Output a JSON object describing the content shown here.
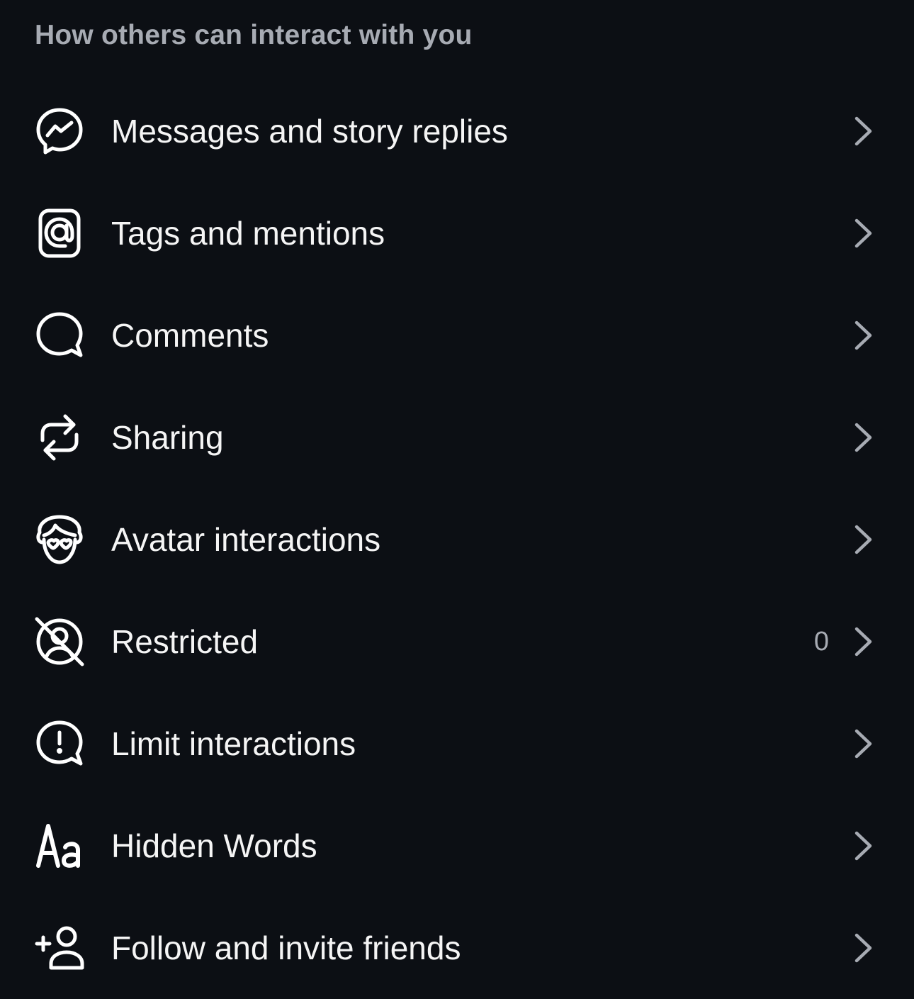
{
  "section": {
    "title": "How others can interact with you"
  },
  "items": [
    {
      "label": "Messages and story replies",
      "icon": "messenger-icon",
      "count": ""
    },
    {
      "label": "Tags and mentions",
      "icon": "at-sign-icon",
      "count": ""
    },
    {
      "label": "Comments",
      "icon": "comment-bubble-icon",
      "count": ""
    },
    {
      "label": "Sharing",
      "icon": "repost-icon",
      "count": ""
    },
    {
      "label": "Avatar interactions",
      "icon": "avatar-face-icon",
      "count": ""
    },
    {
      "label": "Restricted",
      "icon": "restricted-user-icon",
      "count": "0"
    },
    {
      "label": "Limit interactions",
      "icon": "alert-bubble-icon",
      "count": ""
    },
    {
      "label": "Hidden Words",
      "icon": "text-aa-icon",
      "count": ""
    },
    {
      "label": "Follow and invite friends",
      "icon": "add-person-icon",
      "count": ""
    }
  ],
  "colors": {
    "background": "#0c0f14",
    "text": "#f5f5f5",
    "muted": "#a7abb3",
    "chevron": "#a7abb3"
  }
}
